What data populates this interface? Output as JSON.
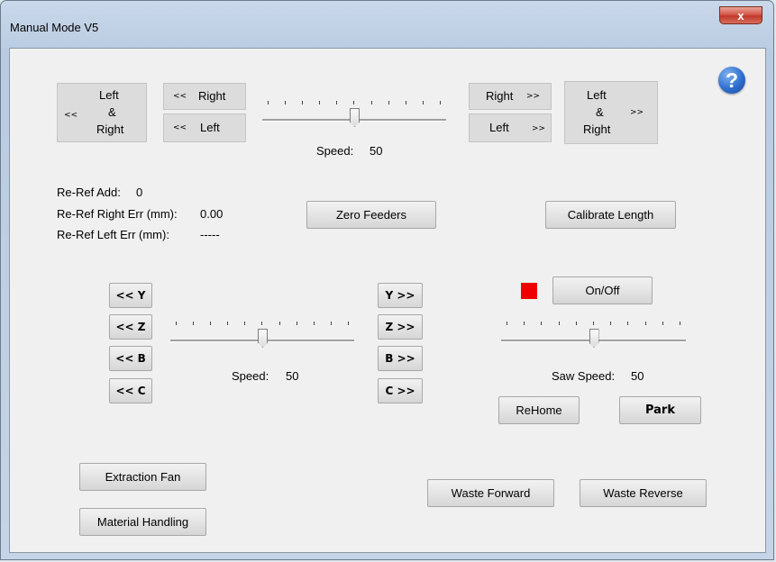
{
  "window": {
    "title": "Manual Mode V5",
    "close_label": "x"
  },
  "help": {
    "icon": "help-icon",
    "glyph": "?"
  },
  "feed": {
    "left_right_back": {
      "arrow": "<<",
      "line1": "Left",
      "line2": "&",
      "line3": "Right"
    },
    "right_back": {
      "arrow": "<<",
      "label": "Right"
    },
    "left_back": {
      "arrow": "<<",
      "label": "Left"
    },
    "right_fwd": {
      "label": "Right",
      "arrow": ">>"
    },
    "left_fwd": {
      "label": "Left",
      "arrow": ">>"
    },
    "left_right_fwd": {
      "line1": "Left",
      "line2": "&",
      "line3": "Right",
      "arrow": ">>"
    },
    "speed_label": "Speed:",
    "speed_value": "50",
    "speed_fraction": 0.5
  },
  "reref": {
    "add_label": "Re-Ref Add:",
    "add_value": "0",
    "right_err_label": "Re-Ref Right Err (mm):",
    "right_err_value": "0.00",
    "left_err_label": "Re-Ref Left Err (mm):",
    "left_err_value": "-----"
  },
  "buttons": {
    "zero_feeders": "Zero Feeders",
    "calibrate_length": "Calibrate Length",
    "on_off": "On/Off",
    "rehome": "ReHome",
    "park": "Park",
    "extraction_fan": "Extraction Fan",
    "material_handling": "Material Handling",
    "waste_forward": "Waste Forward",
    "waste_reverse": "Waste Reverse"
  },
  "axes": {
    "y_back": "<< Y",
    "z_back": "<< Z",
    "b_back": "<< B",
    "c_back": "<< C",
    "y_fwd": "Y >>",
    "z_fwd": "Z >>",
    "b_fwd": "B >>",
    "c_fwd": "C >>",
    "speed_label": "Speed:",
    "speed_value": "50",
    "speed_fraction": 0.5
  },
  "saw": {
    "speed_label": "Saw Speed:",
    "speed_value": "50",
    "speed_fraction": 0.5,
    "status_color": "#ee0000"
  }
}
